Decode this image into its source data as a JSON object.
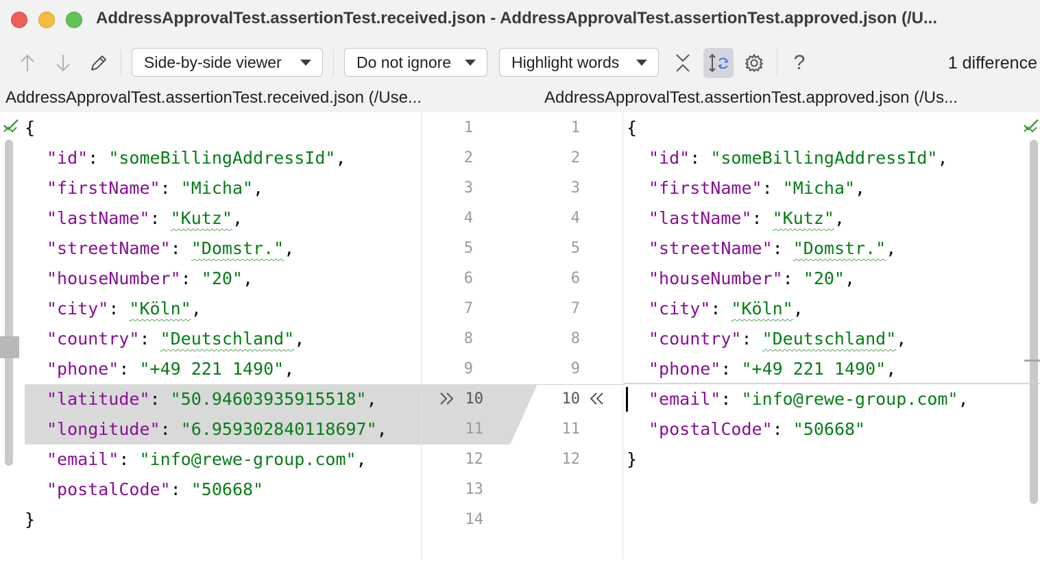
{
  "window": {
    "title": "AddressApprovalTest.assertionTest.received.json - AddressApprovalTest.assertionTest.approved.json (/U..."
  },
  "toolbar": {
    "viewer": "Side-by-side viewer",
    "ignore": "Do not ignore",
    "highlight": "Highlight words",
    "help": "?",
    "diff_count": "1 difference"
  },
  "left": {
    "file": "AddressApprovalTest.assertionTest.received.json (/Use...",
    "line_numbers": [
      "1",
      "2",
      "3",
      "4",
      "5",
      "6",
      "7",
      "8",
      "9",
      "10",
      "11",
      "12",
      "13",
      "14"
    ],
    "changed_lines": [
      10,
      11
    ]
  },
  "right": {
    "file": "AddressApprovalTest.assertionTest.approved.json (/Us...",
    "line_numbers": [
      "1",
      "2",
      "3",
      "4",
      "5",
      "6",
      "7",
      "8",
      "9",
      "10",
      "11",
      "12"
    ]
  },
  "code": {
    "open_brace": "{",
    "close_brace": "}",
    "colon": ": ",
    "comma": ",",
    "fields": {
      "id": {
        "key": "\"id\"",
        "value": "\"someBillingAddressId\""
      },
      "firstName": {
        "key": "\"firstName\"",
        "value": "\"Micha\""
      },
      "lastName": {
        "key": "\"lastName\"",
        "value": "\"Kutz\""
      },
      "streetName": {
        "key": "\"streetName\"",
        "value": "\"Domstr.\""
      },
      "houseNumber": {
        "key": "\"houseNumber\"",
        "value": "\"20\""
      },
      "city": {
        "key": "\"city\"",
        "value": "\"Köln\""
      },
      "country": {
        "key": "\"country\"",
        "value": "\"Deutschland\""
      },
      "phone": {
        "key": "\"phone\"",
        "value": "\"+49 221 1490\""
      },
      "latitude": {
        "key": "\"latitude\"",
        "value": "\"50.94603935915518\""
      },
      "longitude": {
        "key": "\"longitude\"",
        "value": "\"6.959302840118697\""
      },
      "email": {
        "key": "\"email\"",
        "value": "\"info@rewe-group.com\""
      },
      "postalCode": {
        "key": "\"postalCode\"",
        "value": "\"50668\""
      }
    }
  },
  "colors": {
    "key": "#871094",
    "string": "#067d17",
    "changed_bg": "#d9d9d9",
    "accent_check": "#3a9a3a"
  }
}
